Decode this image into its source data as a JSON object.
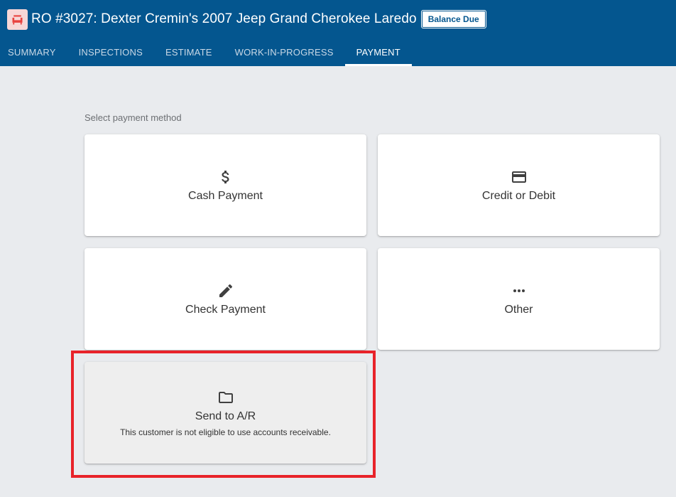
{
  "header": {
    "title": "RO #3027: Dexter Cremin's 2007 Jeep Grand Cherokee Laredo",
    "status_badge": "Balance Due",
    "logo_icon": "car-seat-icon",
    "background_color": "#04568f"
  },
  "tabs": [
    {
      "label": "SUMMARY",
      "active": false
    },
    {
      "label": "INSPECTIONS",
      "active": false
    },
    {
      "label": "ESTIMATE",
      "active": false
    },
    {
      "label": "WORK-IN-PROGRESS",
      "active": false
    },
    {
      "label": "PAYMENT",
      "active": true
    }
  ],
  "payment": {
    "section_label": "Select payment method",
    "methods": [
      {
        "label": "Cash Payment",
        "icon": "dollar-icon",
        "enabled": true
      },
      {
        "label": "Credit or Debit",
        "icon": "credit-card-icon",
        "enabled": true
      },
      {
        "label": "Check Payment",
        "icon": "pencil-icon",
        "enabled": true
      },
      {
        "label": "Other",
        "icon": "more-horizontal-icon",
        "enabled": true
      },
      {
        "label": "Send to A/R",
        "icon": "folder-icon",
        "enabled": false,
        "note": "This customer is not eligible to use accounts receivable."
      }
    ]
  },
  "highlight_color": "#e8232a"
}
